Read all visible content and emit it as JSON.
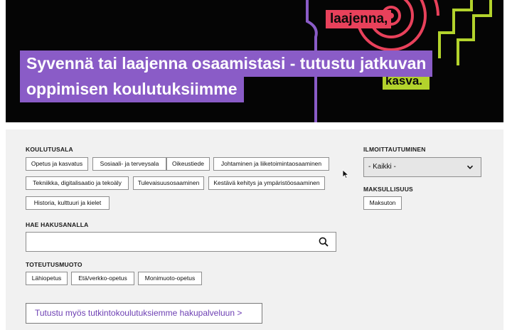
{
  "hero": {
    "title": "Syvennä tai laajenna osaamistasi - tutustu jatkuvan oppimisen koulutuksiimme",
    "tag_laajenna": "laajenna,",
    "tag_kasva": "kasva.",
    "colors": {
      "purple": "#8a5cc7",
      "pink": "#e8415b",
      "green": "#b3d32c",
      "background": "#050505"
    }
  },
  "filters": {
    "koulutusala": {
      "label": "KOULUTUSALA",
      "chips": [
        "Opetus ja kasvatus",
        "Sosiaali- ja terveysala",
        "Oikeustiede",
        "Johtaminen ja liiketoimintaosaaminen",
        "Tekniikka, digitalisaatio ja tekoäly",
        "Tulevaisuusosaaminen",
        "Kestävä kehitys ja ympäristöosaaminen",
        "Historia, kulttuuri ja kielet"
      ]
    },
    "ilmoittautuminen": {
      "label": "ILMOITTAUTUMINEN",
      "selected": "- Kaikki -"
    },
    "maksullisuus": {
      "label": "MAKSULLISUUS",
      "chips": [
        "Maksuton"
      ]
    },
    "search": {
      "label": "HAE HAKUSANALLA",
      "value": "",
      "placeholder": "",
      "icon": "search-icon"
    },
    "toteutusmuoto": {
      "label": "TOTEUTUSMUOTO",
      "chips": [
        "Lähiopetus",
        "Etä/verkko-opetus",
        "Monimuoto-opetus"
      ]
    }
  },
  "cta": {
    "label": "Tutustu myös tutkintokoulutuksiemme hakupalveluun >"
  }
}
